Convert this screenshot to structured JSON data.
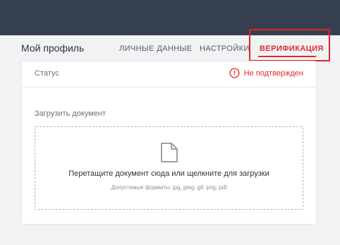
{
  "profile": {
    "title": "Мой профиль",
    "tabs": [
      {
        "label": "ЛИЧНЫЕ ДАННЫЕ"
      },
      {
        "label": "НАСТРОЙКИ"
      },
      {
        "label": "ВЕРИФИКАЦИЯ"
      }
    ],
    "active_tab": "ВЕРИФИКАЦИЯ"
  },
  "status": {
    "label": "Статус",
    "value": "Не подтвержден",
    "icon": "alert-circle-icon"
  },
  "upload": {
    "label": "Загрузить документ",
    "drop_text": "Перетащите документ сюда или щелкните для загрузки",
    "formats_text": "Допустимые форматы: jpg, jpeg, gif, png, pdf",
    "icon": "file-icon"
  },
  "colors": {
    "topbar": "#363f50",
    "accent": "#e02d2d",
    "background": "#f1f2f4"
  }
}
